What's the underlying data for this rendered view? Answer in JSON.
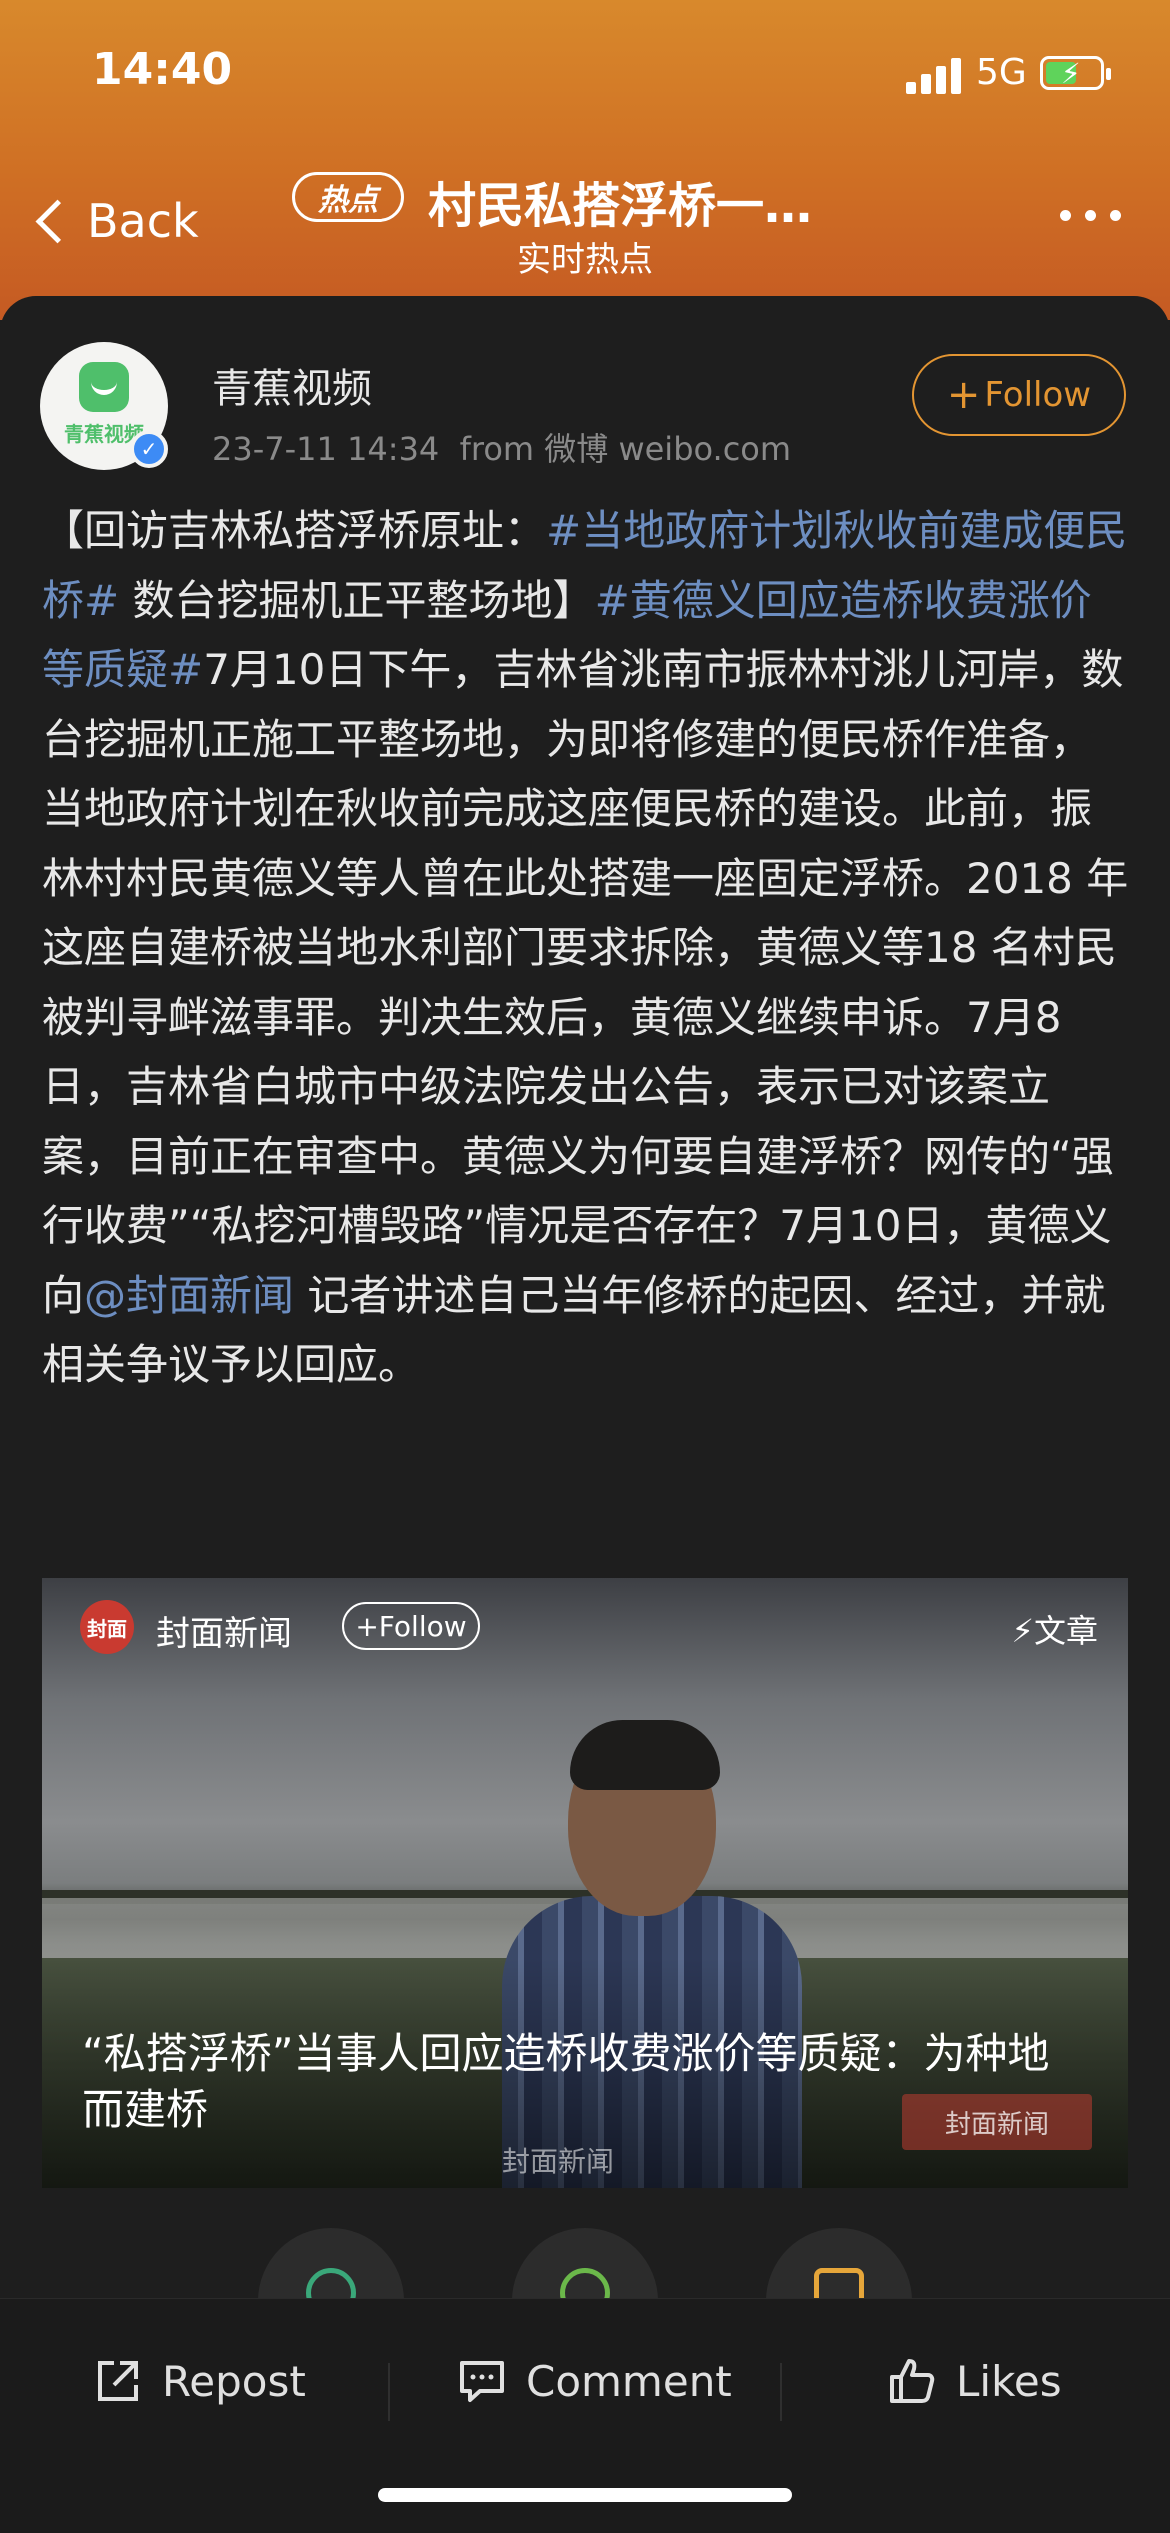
{
  "status_bar": {
    "time": "14:40",
    "network": "5G"
  },
  "nav": {
    "back_label": "Back",
    "badge": "热点",
    "title": "村民私搭浮桥一…",
    "subtitle": "实时热点"
  },
  "post": {
    "author": "青蕉视频",
    "avatar_text": "青蕉视频",
    "time": "23-7-11 14:34",
    "source": "from 微博 weibo.com",
    "follow_label": "Follow",
    "body": [
      {
        "t": "【回访吉林私搭浮桥原址："
      },
      {
        "t": "#当地政府计划秋收前建成便民桥#",
        "tag": true
      },
      {
        "t": " 数台挖掘机正平整场地】"
      },
      {
        "t": "#黄德义回应造桥收费涨价等质疑#",
        "tag": true
      },
      {
        "t": "7月10日下午，吉林省洮南市振林村洮儿河岸，数台挖掘机正施工平整场地，为即将修建的便民桥作准备，当地政府计划在秋收前完成这座便民桥的建设。此前，振林村村民黄德义等人曾在此处搭建一座固定浮桥。2018 年这座自建桥被当地水利部门要求拆除，黄德义等18 名村民被判寻衅滋事罪。判决生效后，黄德义继续申诉。7月8日，吉林省白城市中级法院发出公告，表示已对该案立案，目前正在审查中。黄德义为何要自建浮桥？网传的“强行收费”“私挖河槽毁路”情况是否存在？7月10日，黄德义向"
      },
      {
        "t": "@封面新闻",
        "tag": true
      },
      {
        "t": " 记者讲述自己当年修桥的起因、经过，并就相关争议予以回应。"
      }
    ]
  },
  "media_card": {
    "source_logo": "封面",
    "source_name": "封面新闻",
    "follow_label": "+Follow",
    "type_label": "⚡文章",
    "title": "“私搭浮桥”当事人回应造桥收费涨价等质疑：为种地而建桥",
    "watermark": "封面新闻",
    "watermark2": "封面新闻"
  },
  "toolbar": {
    "repost": "Repost",
    "comment": "Comment",
    "likes": "Likes"
  },
  "colors": {
    "accent": "#e39532",
    "link": "#6d8ec1",
    "header_top": "#d8892c",
    "header_bottom": "#c55a23"
  }
}
